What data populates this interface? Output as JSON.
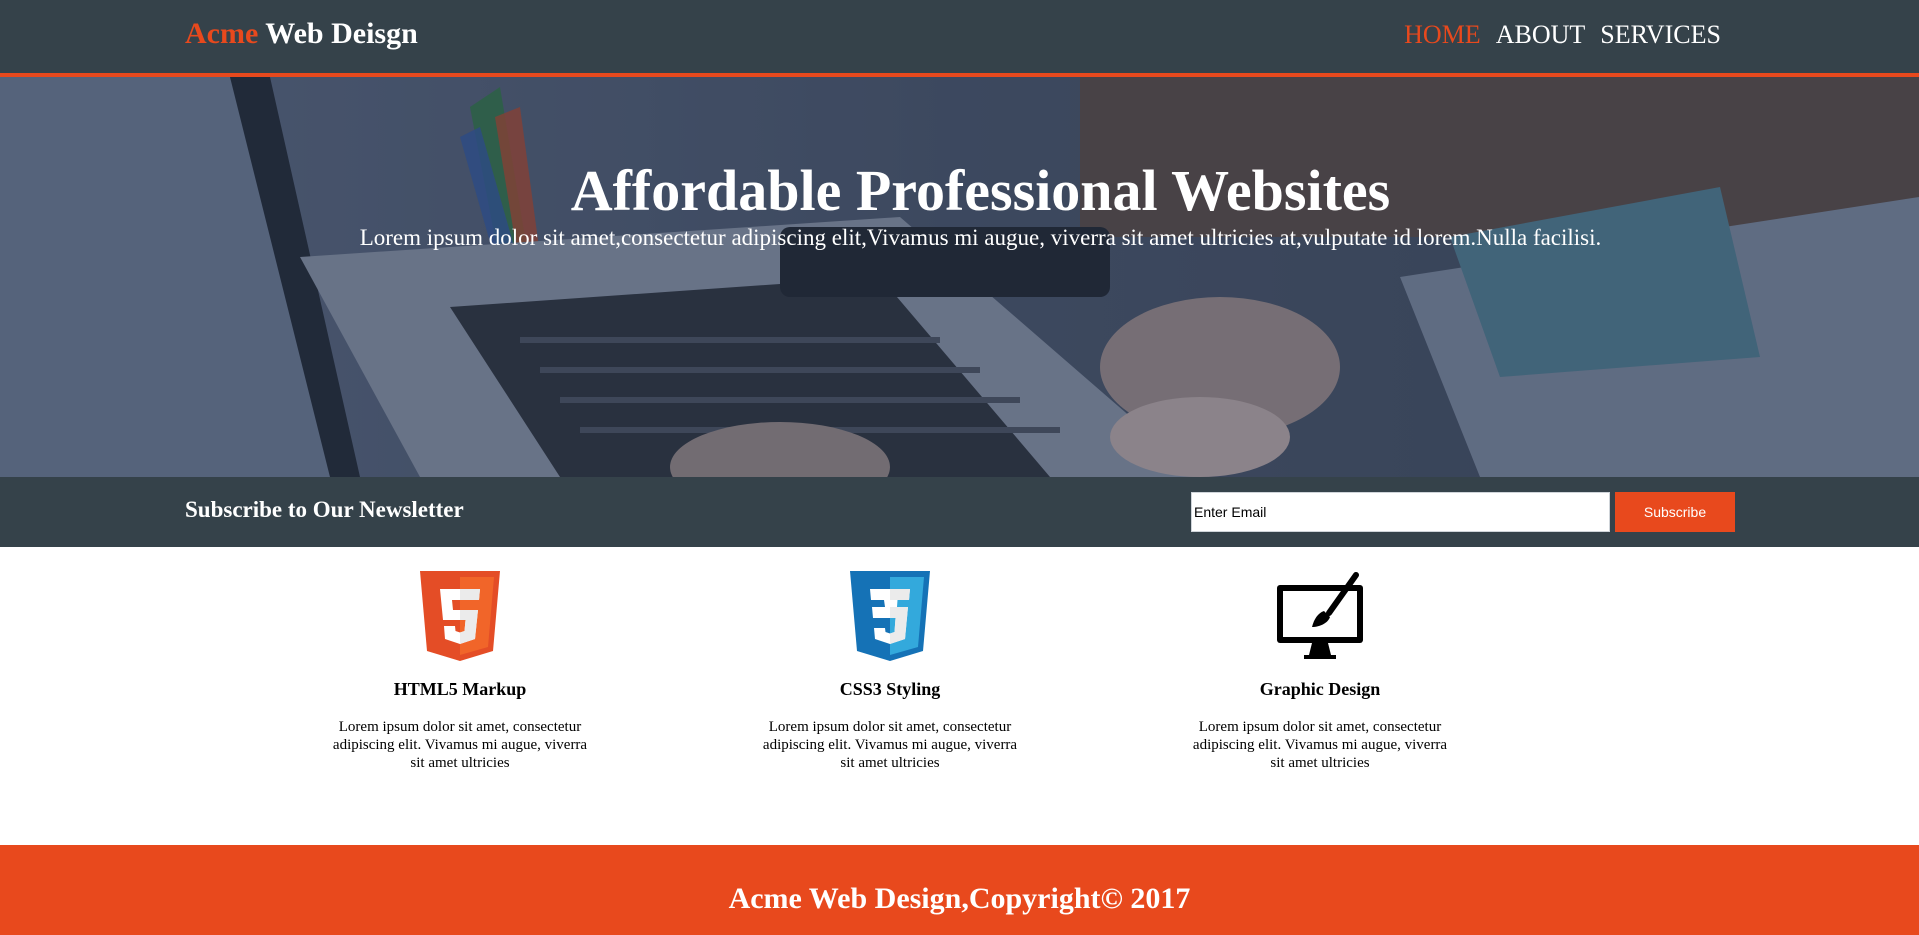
{
  "header": {
    "logo_highlight": "Acme",
    "logo_rest": " Web Deisgn",
    "nav": [
      {
        "label": "HOME"
      },
      {
        "label": "ABOUT"
      },
      {
        "label": "SERVICES"
      }
    ],
    "active_nav_color": "#e8491d"
  },
  "showcase": {
    "title": "Affordable Professional Websites",
    "text": "Lorem ipsum dolor sit amet,consectetur adipiscing elit,Vivamus mi augue, viverra sit amet ultricies at,vulputate id lorem.Nulla facilisi."
  },
  "newsletter": {
    "heading": "Subscribe to Our Newsletter",
    "email_placeholder": "Enter Email",
    "button_label": "Subscribe"
  },
  "boxes": [
    {
      "icon": "html5-icon",
      "title": "HTML5 Markup",
      "text": "Lorem ipsum dolor sit amet, consectetur adipiscing elit. Vivamus mi augue, viverra sit amet ultricies"
    },
    {
      "icon": "css3-icon",
      "title": "CSS3 Styling",
      "text": "Lorem ipsum dolor sit amet, consectetur adipiscing elit. Vivamus mi augue, viverra sit amet ultricies"
    },
    {
      "icon": "monitor-brush-icon",
      "title": "Graphic Design",
      "text": "Lorem ipsum dolor sit amet, consectetur adipiscing elit. Vivamus mi augue, viverra sit amet ultricies"
    }
  ],
  "footer": {
    "copyright": "Acme Web Design,Copyright© 2017"
  },
  "colors": {
    "brand_dark": "#35424a",
    "accent": "#e8491d",
    "html5_orange": "#e44d26",
    "css3_blue": "#1572b6"
  }
}
